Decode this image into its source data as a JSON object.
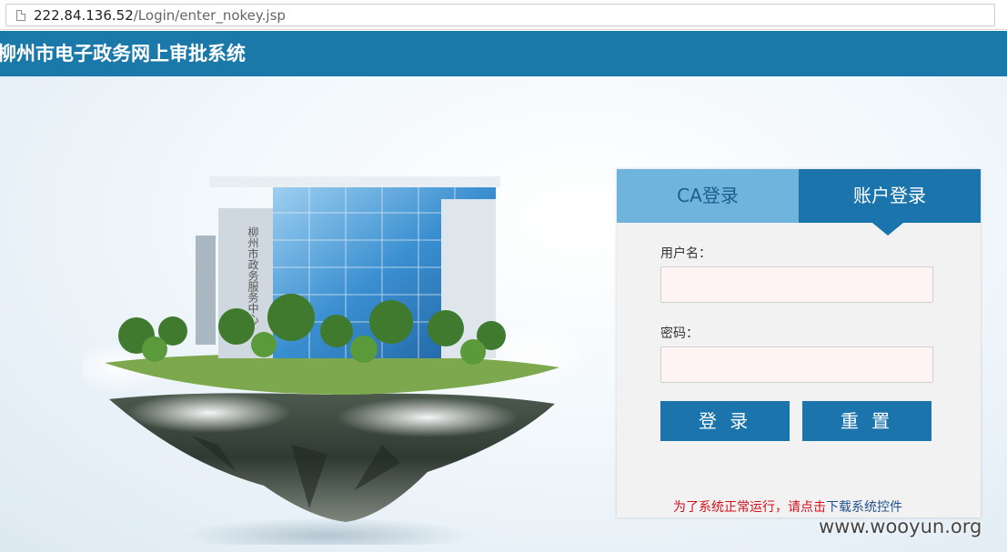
{
  "browser": {
    "url_host": "222.84.136.52",
    "url_path": "/Login/enter_nokey.jsp"
  },
  "header": {
    "title": "柳州市电子政务网上审批系统"
  },
  "illustration": {
    "building_sign": "柳州市政务服务中心"
  },
  "login": {
    "tabs": [
      {
        "label": "CA登录"
      },
      {
        "label": "账户登录"
      }
    ],
    "active_tab": "账户登录",
    "username_label": "用户名：",
    "username_value": "",
    "password_label": "密码：",
    "password_value": "",
    "login_button": "登 录",
    "reset_button": "重 置",
    "note_text": "为了系统正常运行，请点击",
    "note_link": "下载系统控件"
  },
  "watermark": "www.wooyun.org",
  "colors": {
    "header_bg": "#1b79aa",
    "tab_active": "#1b75ac",
    "tab_inactive": "#6fb4dc",
    "button_bg": "#1b75ac",
    "note_red": "#d4101a",
    "note_link": "#24538c"
  }
}
